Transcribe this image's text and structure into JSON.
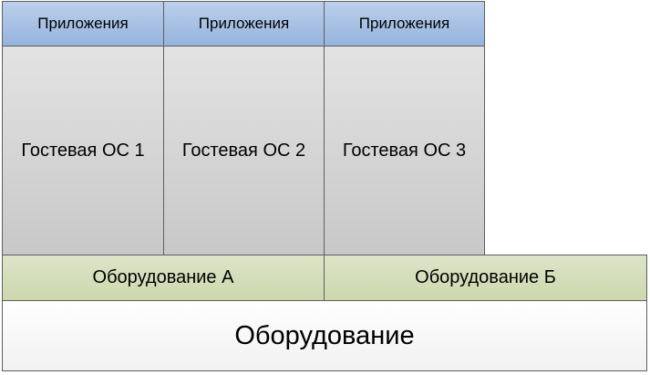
{
  "columns": [
    {
      "apps_label": "Приложения",
      "guest_os_label": "Гостевая ОС 1"
    },
    {
      "apps_label": "Приложения",
      "guest_os_label": "Гостевая ОС 2"
    },
    {
      "apps_label": "Приложения",
      "guest_os_label": "Гостевая ОС 3"
    }
  ],
  "hardware_a": {
    "label": "Оборудование А"
  },
  "hardware_b": {
    "label": "Оборудование Б"
  },
  "base_hardware": {
    "label": "Оборудование"
  },
  "colors": {
    "applications_fill": "#a9c1e4",
    "guest_os_fill": "#d6d6d6",
    "hardware_fill": "#d5deba",
    "base_fill": "#f8f8f8",
    "border": "#5f5f5f"
  }
}
